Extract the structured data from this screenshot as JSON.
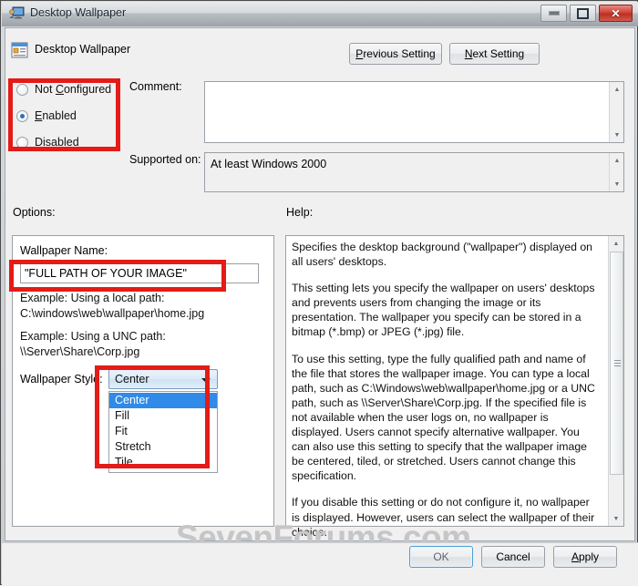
{
  "window": {
    "title": "Desktop Wallpaper",
    "title_icon": "desktop-wallpaper-icon",
    "controls": {
      "minimize": "minimize-button",
      "maximize": "maximize-button",
      "close_label": "✕"
    }
  },
  "header": {
    "icon": "policy-setting-icon",
    "title": "Desktop Wallpaper",
    "previous_setting": "Previous Setting",
    "previous_setting_accel": "P",
    "next_setting": "Next Setting",
    "next_setting_accel": "N"
  },
  "state": {
    "options": [
      {
        "label_before": "Not ",
        "accel": "C",
        "label_after": "onfigured",
        "selected": false
      },
      {
        "label_before": "",
        "accel": "E",
        "label_after": "nabled",
        "selected": true
      },
      {
        "label_before": "",
        "accel": "D",
        "label_after": "isabled",
        "selected": false
      }
    ],
    "selected_value": "Enabled"
  },
  "comment": {
    "label": "Comment:",
    "value": "",
    "placeholder": ""
  },
  "supported_on": {
    "label": "Supported on:",
    "value": "At least Windows 2000"
  },
  "panels": {
    "options_label": "Options:",
    "help_label": "Help:"
  },
  "options": {
    "wallpaper_name_label": "Wallpaper Name:",
    "wallpaper_name_value": "\"FULL PATH OF YOUR IMAGE\"",
    "example_local_title": "Example: Using a local path:",
    "example_local_path": "C:\\windows\\web\\wallpaper\\home.jpg",
    "example_unc_title": "Example: Using a UNC path:",
    "example_unc_path": "\\\\Server\\Share\\Corp.jpg",
    "wallpaper_style_label": "Wallpaper Style:",
    "wallpaper_style_value": "Center",
    "wallpaper_style_options": [
      "Center",
      "Fill",
      "Fit",
      "Stretch",
      "Tile"
    ],
    "wallpaper_style_open": true
  },
  "help": {
    "paragraph_1": "Specifies the desktop background (\"wallpaper\") displayed on all users' desktops.",
    "paragraph_2": "This setting lets you specify the wallpaper on users' desktops and prevents users from changing the image or its presentation. The wallpaper you specify can be stored in a bitmap (*.bmp) or JPEG (*.jpg) file.",
    "paragraph_3": "To use this setting, type the fully qualified path and name of the file that stores the wallpaper image. You can type a local path, such as C:\\Windows\\web\\wallpaper\\home.jpg or a UNC path, such as \\\\Server\\Share\\Corp.jpg. If the specified file is not available when the user logs on, no wallpaper is displayed. Users cannot specify alternative wallpaper. You can also use this setting to specify that the wallpaper image be centered, tiled, or stretched. Users cannot change this specification.",
    "paragraph_4": "If you disable this setting or do not configure it, no wallpaper is displayed. However, users can select the wallpaper of their choice."
  },
  "footer": {
    "ok": "OK",
    "cancel": "Cancel",
    "apply_before": "",
    "apply_accel": "A",
    "apply_after": "pply"
  },
  "watermark": "SevenForums.com",
  "annotations": {
    "highlight_color": "#e41b17",
    "boxes": [
      "state-group",
      "wallpaper-name-field",
      "wallpaper-style-dropdown"
    ]
  },
  "colors": {
    "accent_blue": "#2f8ae8",
    "close_red": "#cf4338",
    "highlight_red": "#e41b17",
    "watermark_gray": "#c6c6c6"
  }
}
